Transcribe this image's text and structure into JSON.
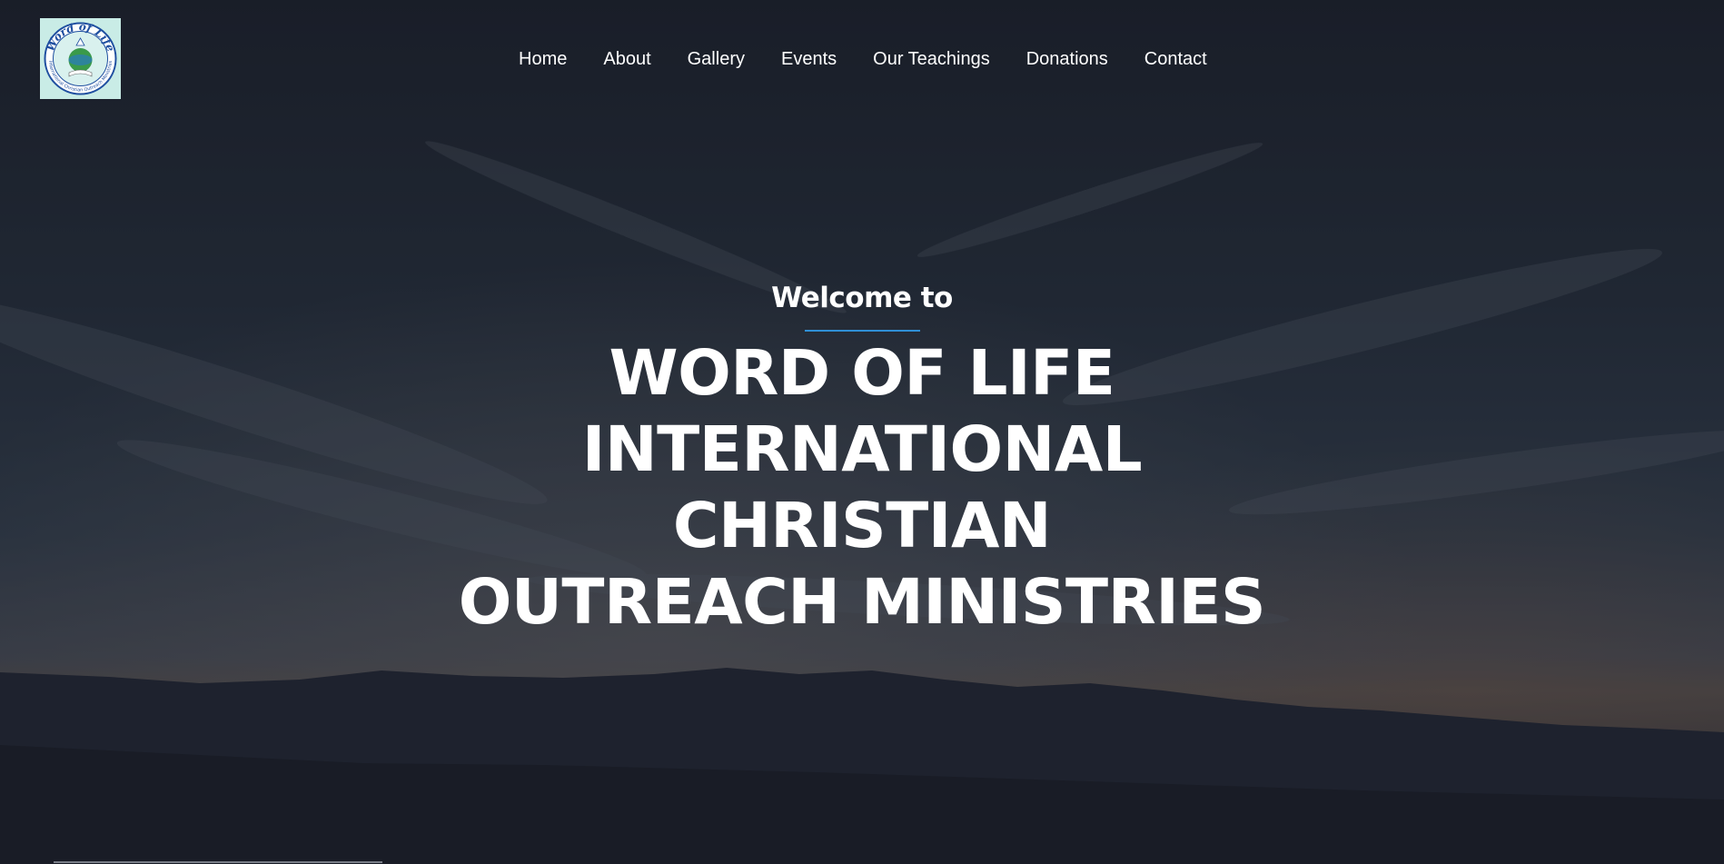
{
  "site": {
    "logo": {
      "icon": "word-of-life-logo",
      "text_top": "Word of Life",
      "text_ring": "International Christian Outreach Ministries"
    }
  },
  "nav": {
    "items": [
      {
        "label": "Home"
      },
      {
        "label": "About"
      },
      {
        "label": "Gallery"
      },
      {
        "label": "Events"
      },
      {
        "label": "Our Teachings"
      },
      {
        "label": "Donations"
      },
      {
        "label": "Contact"
      }
    ]
  },
  "hero": {
    "welcome": "Welcome to",
    "title_lines": [
      "WORD OF LIFE",
      "INTERNATIONAL CHRISTIAN",
      "OUTREACH MINISTRIES"
    ]
  },
  "colors": {
    "accent": "#2f8fd6",
    "text": "#ffffff",
    "background": "#1c212c"
  }
}
